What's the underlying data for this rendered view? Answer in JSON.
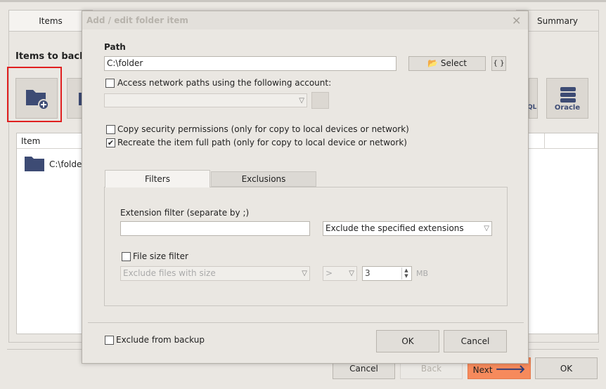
{
  "background": {
    "tabs": {
      "items": "Items",
      "summary": "Summary"
    },
    "section_title": "Items to backu",
    "oracle_label": "Oracle",
    "sql_label": "QL",
    "list_header": "Item",
    "list_row": "C:\\folder",
    "footer": {
      "cancel": "Cancel",
      "back": "Back",
      "next": "Next",
      "ok": "OK"
    },
    "accent": "#f68a5c"
  },
  "dialog": {
    "title": "Add / edit folder item",
    "path_label": "Path",
    "path_value": "C:\\folder",
    "select_label": "Select",
    "vars_label": "{ }",
    "network_label": "Access network paths using the following account:",
    "copy_perm_label": "Copy security permissions (only for copy to local devices or network)",
    "recreate_label": "Recreate the item full path (only for copy to local device or network)",
    "recreate_checked": "✔",
    "tabs": {
      "filters": "Filters",
      "exclusions": "Exclusions"
    },
    "ext_label": "Extension filter (separate by ;)",
    "ext_mode": "Exclude the specified extensions",
    "size_label": "File size filter",
    "size_mode": "Exclude files with size",
    "size_op": ">",
    "size_value": "3",
    "size_unit": "MB",
    "exclude_label": "Exclude from backup",
    "ok": "OK",
    "cancel": "Cancel"
  }
}
